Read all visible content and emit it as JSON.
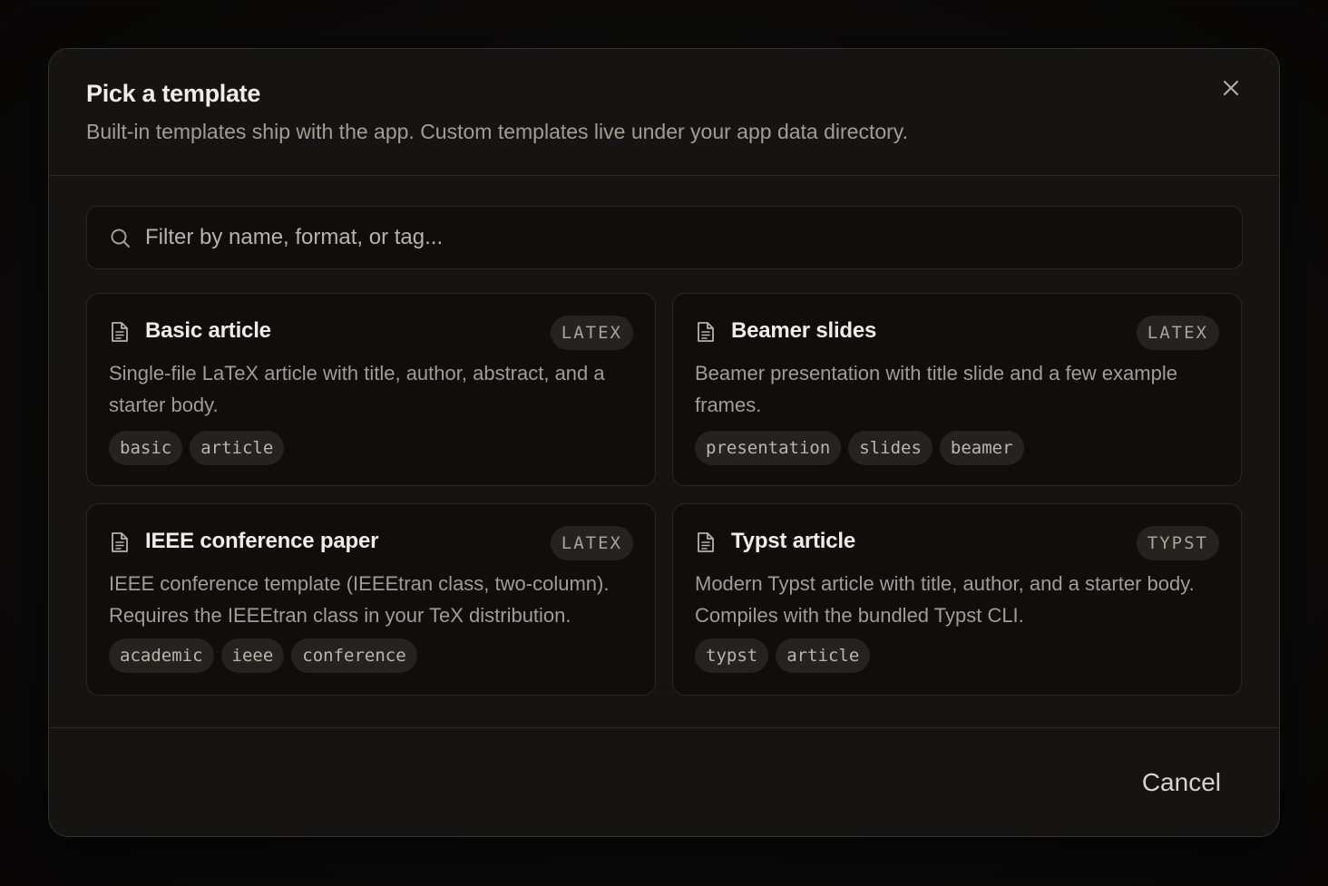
{
  "dialog": {
    "title": "Pick a template",
    "subtitle": "Built-in templates ship with the app. Custom templates live under your app data directory.",
    "close_icon": "close-icon"
  },
  "search": {
    "placeholder": "Filter by name, format, or tag...",
    "value": "",
    "icon": "search-icon"
  },
  "templates": [
    {
      "title": "Basic article",
      "format": "LATEX",
      "description": "Single-file LaTeX article with title, author, abstract, and a starter body.",
      "tags": [
        "basic",
        "article"
      ],
      "icon": "document-icon"
    },
    {
      "title": "Beamer slides",
      "format": "LATEX",
      "description": "Beamer presentation with title slide and a few example frames.",
      "tags": [
        "presentation",
        "slides",
        "beamer"
      ],
      "icon": "document-icon"
    },
    {
      "title": "IEEE conference paper",
      "format": "LATEX",
      "description": "IEEE conference template (IEEEtran class, two-column). Requires the IEEEtran class in your TeX distribution.",
      "tags": [
        "academic",
        "ieee",
        "conference"
      ],
      "icon": "document-icon"
    },
    {
      "title": "Typst article",
      "format": "TYPST",
      "description": "Modern Typst article with title, author, and a starter body. Compiles with the bundled Typst CLI.",
      "tags": [
        "typst",
        "article"
      ],
      "icon": "document-icon"
    }
  ],
  "footer": {
    "cancel_label": "Cancel"
  },
  "colors": {
    "background": "#0a0908",
    "modal": "#161412",
    "card": "#0f0e0c",
    "pill": "#252220",
    "text_primary": "#f1ede6",
    "text_secondary": "#a39c92"
  }
}
